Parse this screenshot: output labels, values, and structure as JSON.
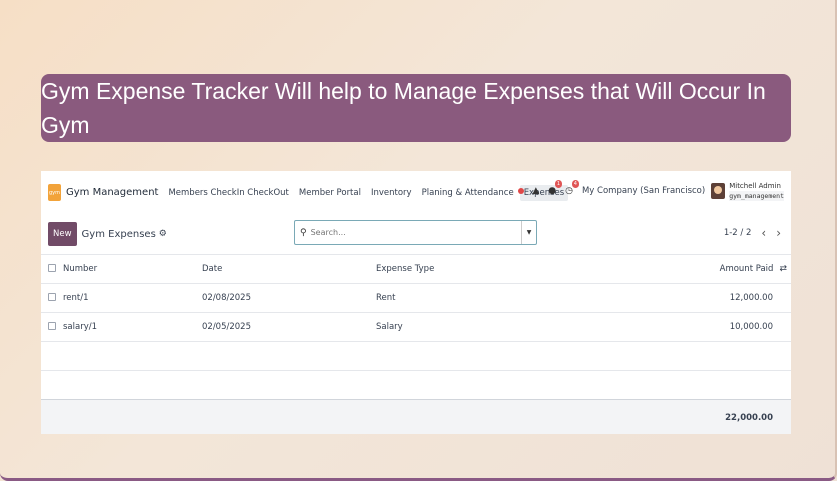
{
  "banner": {
    "line1": "Gym Expense Tracker Will help to Manage Expenses that Will Occur In",
    "line2": "Gym"
  },
  "navbar": {
    "app_logo": "gym",
    "app_name": "Gym Management",
    "menu": [
      {
        "label": "Members CheckIn CheckOut"
      },
      {
        "label": "Member Portal"
      },
      {
        "label": "Inventory"
      },
      {
        "label": "Planing & Attendance"
      },
      {
        "label": "Expenses"
      }
    ],
    "chat_badge": "1",
    "activity_badge": "4",
    "company": "My Company (San Francisco)",
    "user_name": "Mitchell Admin",
    "user_db": "gym_management"
  },
  "control": {
    "new_label": "New",
    "view_title": "Gym Expenses",
    "search_placeholder": "Search...",
    "pager": "1-2 / 2"
  },
  "table": {
    "headers": {
      "number": "Number",
      "date": "Date",
      "type": "Expense Type",
      "amount": "Amount Paid"
    },
    "rows": [
      {
        "number": "rent/1",
        "date": "02/08/2025",
        "type": "Rent",
        "amount": "12,000.00"
      },
      {
        "number": "salary/1",
        "date": "02/05/2025",
        "type": "Salary",
        "amount": "10,000.00"
      }
    ],
    "total": "22,000.00"
  },
  "colors": {
    "banner_bg": "#8a5a7e",
    "primary": "#714b67",
    "app_icon": "#f2a33a"
  }
}
